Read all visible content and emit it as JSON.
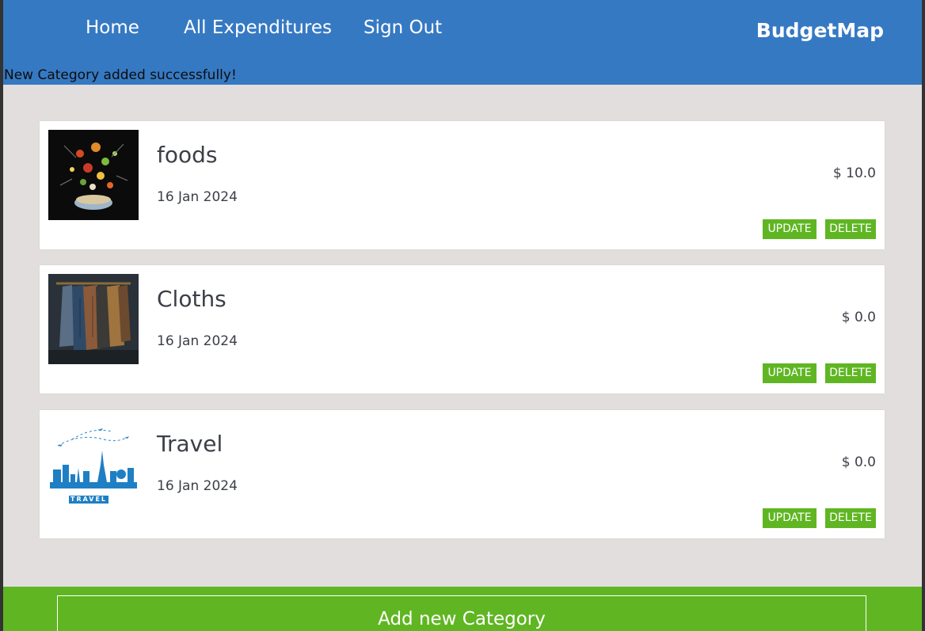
{
  "nav": {
    "home": "Home",
    "all_expenditures": "All Expenditures",
    "sign_out": "Sign Out",
    "brand": "BudgetMap"
  },
  "flash": "New Category added successfully!",
  "categories": [
    {
      "name": "foods",
      "date": "16 Jan 2024",
      "amount": "$ 10.0",
      "image": "food-bowl-image",
      "update_label": "UPDATE",
      "delete_label": "DELETE"
    },
    {
      "name": "Cloths",
      "date": "16 Jan 2024",
      "amount": "$ 0.0",
      "image": "jackets-image",
      "update_label": "UPDATE",
      "delete_label": "DELETE"
    },
    {
      "name": "Travel",
      "date": "16 Jan 2024",
      "amount": "$ 0.0",
      "image": "travel-skyline-image",
      "update_label": "UPDATE",
      "delete_label": "DELETE"
    }
  ],
  "travel_logo_text": "TRAVEL",
  "footer": {
    "add_label": "Add new Category"
  },
  "colors": {
    "header": "#3679c3",
    "background": "#e2dedd",
    "accent_green": "#5fb622",
    "text": "#3c3f47"
  }
}
